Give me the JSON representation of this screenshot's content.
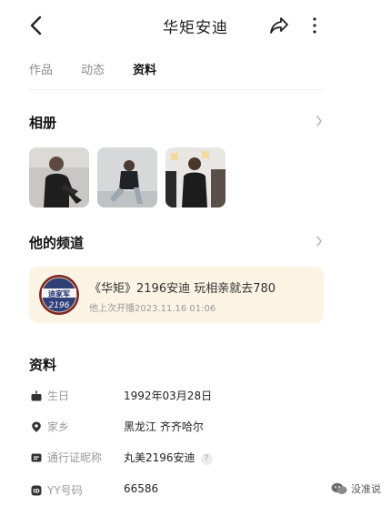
{
  "header": {
    "title": "华矩安迪",
    "back_icon": "chevron-left-icon",
    "share_icon": "share-icon",
    "more_icon": "more-vertical-icon"
  },
  "tabs": [
    {
      "label": "作品",
      "active": false
    },
    {
      "label": "动态",
      "active": false
    },
    {
      "label": "资料",
      "active": true
    }
  ],
  "album": {
    "title": "相册",
    "photos": [
      "photo-1",
      "photo-2",
      "photo-3"
    ]
  },
  "channel": {
    "title": "他的频道",
    "logo_text_top": "迪家军",
    "logo_text_bottom": "2196",
    "name": "《华矩》2196安迪  玩相亲就去780",
    "last_live": "他上次开播2023.11.16 01:06"
  },
  "profile": {
    "title": "资料",
    "rows": [
      {
        "icon": "cake-icon",
        "label": "生日",
        "value": "1992年03月28日"
      },
      {
        "icon": "location-pin-icon",
        "label": "家乡",
        "value": "黑龙江  齐齐哈尔"
      },
      {
        "icon": "id-card-icon",
        "label": "通行证昵称",
        "value": "丸美2196安迪",
        "help": "?"
      },
      {
        "icon": "yy-id-icon",
        "label": "YY号码",
        "value": "66586"
      }
    ]
  },
  "watermark": {
    "text": "没准说"
  }
}
